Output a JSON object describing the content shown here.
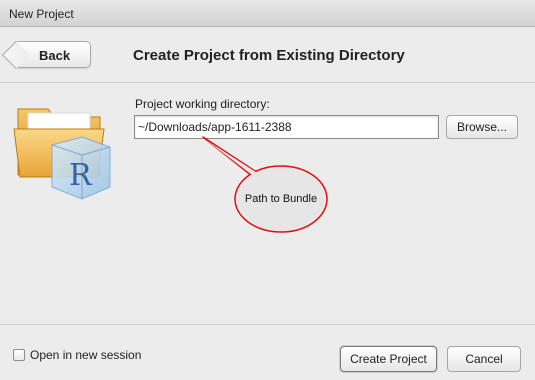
{
  "window": {
    "title": "New Project"
  },
  "header": {
    "back_label": "Back",
    "title": "Create Project from Existing Directory"
  },
  "main": {
    "directory_label": "Project working directory:",
    "directory_value": "~/Downloads/app-1611-2388",
    "browse_label": "Browse...",
    "annotation": "Path to Bundle",
    "icon": "r-project-folder-icon"
  },
  "footer": {
    "new_session_label": "Open in new session",
    "new_session_checked": false,
    "create_label": "Create Project",
    "cancel_label": "Cancel"
  },
  "colors": {
    "callout_border": "#e01010",
    "callout_fill": "#e6e6e6"
  }
}
